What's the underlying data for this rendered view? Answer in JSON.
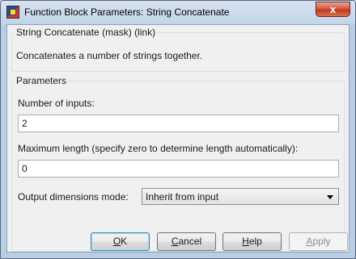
{
  "window": {
    "title": "Function Block Parameters: String Concatenate",
    "close_glyph": "x"
  },
  "description_group": {
    "title": "String Concatenate (mask) (link)",
    "text": "Concatenates a number of strings together."
  },
  "parameters_group": {
    "title": "Parameters",
    "fields": {
      "num_inputs": {
        "label": "Number of inputs:",
        "value": "2"
      },
      "max_length": {
        "label": "Maximum length (specify zero to determine length automatically):",
        "value": "0"
      },
      "output_dims": {
        "label": "Output dimensions mode:",
        "selected": "Inherit from input"
      }
    }
  },
  "buttons": {
    "ok": {
      "mnemonic": "O",
      "rest": "K"
    },
    "cancel": {
      "mnemonic": "C",
      "rest": "ancel"
    },
    "help": {
      "mnemonic": "H",
      "rest": "elp"
    },
    "apply": {
      "mnemonic": "A",
      "rest": "pply",
      "enabled": false
    }
  }
}
